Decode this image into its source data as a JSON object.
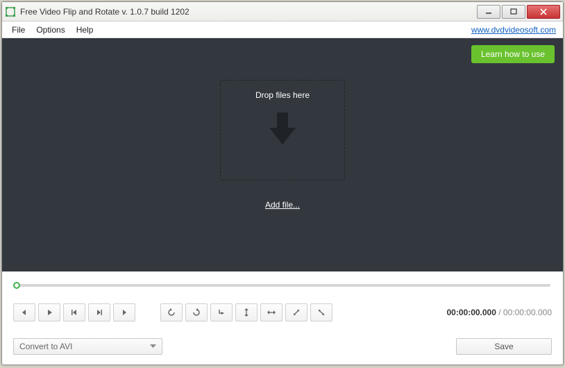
{
  "window": {
    "title": "Free Video Flip and Rotate v. 1.0.7 build 1202"
  },
  "menubar": {
    "items": [
      "File",
      "Options",
      "Help"
    ],
    "site_link": "www.dvdvideosoft.com"
  },
  "preview": {
    "learn_button": "Learn how to use",
    "drop_label": "Drop files here",
    "add_file": "Add file..."
  },
  "time": {
    "current": "00:00:00.000",
    "separator": "/",
    "total": "00:00:00.000"
  },
  "bottom": {
    "format_selected": "Convert to AVI",
    "save_label": "Save"
  }
}
